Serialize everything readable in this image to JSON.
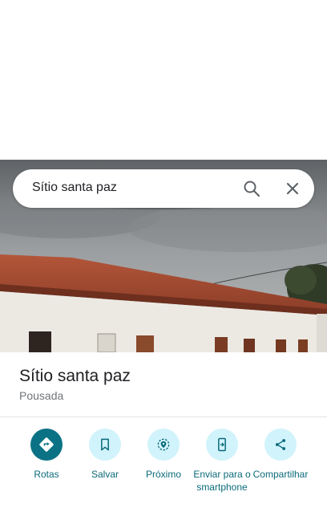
{
  "search": {
    "query": "Sítio santa paz",
    "search_icon": "search-icon",
    "close_icon": "close-icon"
  },
  "place": {
    "name": "Sítio santa paz",
    "category": "Pousada"
  },
  "actions": [
    {
      "label": "Rotas",
      "icon": "directions-icon"
    },
    {
      "label": "Salvar",
      "icon": "bookmark-icon"
    },
    {
      "label": "Próximo",
      "icon": "nearby-icon"
    },
    {
      "label": "Enviar para o smartphone",
      "icon": "send-to-phone-icon"
    },
    {
      "label": "Compartilhar",
      "icon": "share-icon"
    }
  ],
  "colors": {
    "accent": "#0b7285",
    "action_bg": "#d1f3fb",
    "label": "#0b6a7a"
  }
}
